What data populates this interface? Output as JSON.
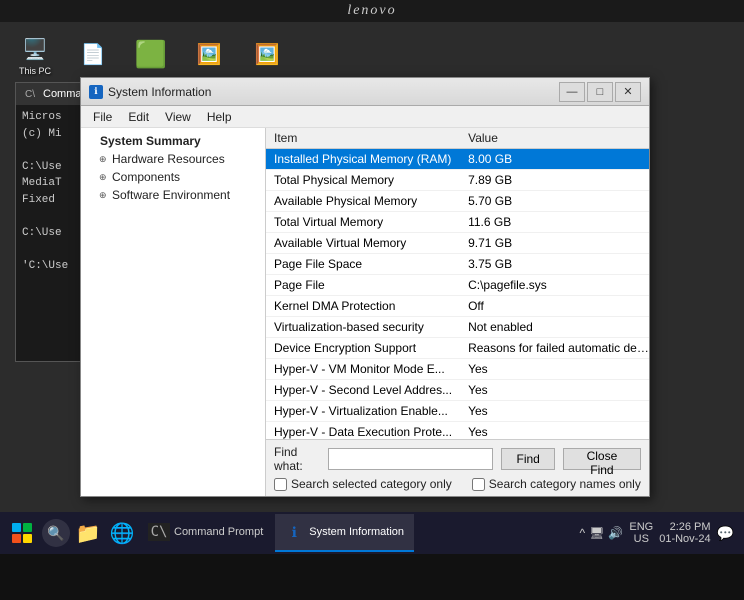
{
  "brand": "lenovo",
  "desktop": {
    "icons": [
      {
        "label": "This PC",
        "icon": "🖥️"
      },
      {
        "label": "",
        "icon": "📄"
      },
      {
        "label": "",
        "icon": "🟩"
      },
      {
        "label": "",
        "icon": "🖼️"
      },
      {
        "label": "",
        "icon": "🖼️"
      }
    ]
  },
  "cmd_window": {
    "title": "Command Prompt",
    "lines": [
      "Microsoft Windows",
      "(c) Microsoft Corporation",
      "",
      "C:\\User>",
      "MediaT",
      "Fixed",
      "",
      "C:\\Use>",
      "C:\\Use>"
    ]
  },
  "sysinfo": {
    "title": "System Information",
    "menu": [
      "File",
      "Edit",
      "View",
      "Help"
    ],
    "window_controls": [
      "—",
      "□",
      "✕"
    ],
    "left_panel": {
      "items": [
        {
          "label": "System Summary",
          "level": "root",
          "expander": ""
        },
        {
          "label": "Hardware Resources",
          "level": "child",
          "expander": "⊕"
        },
        {
          "label": "Components",
          "level": "child",
          "expander": "⊕"
        },
        {
          "label": "Software Environment",
          "level": "child",
          "expander": "⊕"
        }
      ]
    },
    "table": {
      "columns": [
        "Item",
        "Value"
      ],
      "rows": [
        {
          "item": "Installed Physical Memory (RAM)",
          "value": "8.00 GB",
          "selected": true
        },
        {
          "item": "Total Physical Memory",
          "value": "7.89 GB",
          "selected": false
        },
        {
          "item": "Available Physical Memory",
          "value": "5.70 GB",
          "selected": false
        },
        {
          "item": "Total Virtual Memory",
          "value": "11.6 GB",
          "selected": false
        },
        {
          "item": "Available Virtual Memory",
          "value": "9.71 GB",
          "selected": false
        },
        {
          "item": "Page File Space",
          "value": "3.75 GB",
          "selected": false
        },
        {
          "item": "Page File",
          "value": "C:\\pagefile.sys",
          "selected": false
        },
        {
          "item": "Kernel DMA Protection",
          "value": "Off",
          "selected": false
        },
        {
          "item": "Virtualization-based security",
          "value": "Not enabled",
          "selected": false
        },
        {
          "item": "Device Encryption Support",
          "value": "Reasons for failed automatic device en",
          "selected": false
        },
        {
          "item": "Hyper-V - VM Monitor Mode E...",
          "value": "Yes",
          "selected": false
        },
        {
          "item": "Hyper-V - Second Level Addres...",
          "value": "Yes",
          "selected": false
        },
        {
          "item": "Hyper-V - Virtualization Enable...",
          "value": "Yes",
          "selected": false
        },
        {
          "item": "Hyper-V - Data Execution Prote...",
          "value": "Yes",
          "selected": false
        }
      ]
    },
    "find": {
      "label": "Find what:",
      "placeholder": "",
      "find_btn": "Find",
      "close_find_btn": "Close Find",
      "checkbox1_label": "Search selected category only",
      "checkbox2_label": "Search category names only"
    }
  },
  "taskbar": {
    "apps": [
      {
        "label": "Command Prompt",
        "active": false,
        "icon": "cmd"
      },
      {
        "label": "System Information",
        "active": true,
        "icon": "sysinfo"
      }
    ],
    "tray": {
      "icons": [
        "^",
        "🖥",
        "🔊"
      ],
      "lang": "ENG",
      "region": "US",
      "time": "2:26 PM",
      "date": "01-Nov-24"
    }
  }
}
